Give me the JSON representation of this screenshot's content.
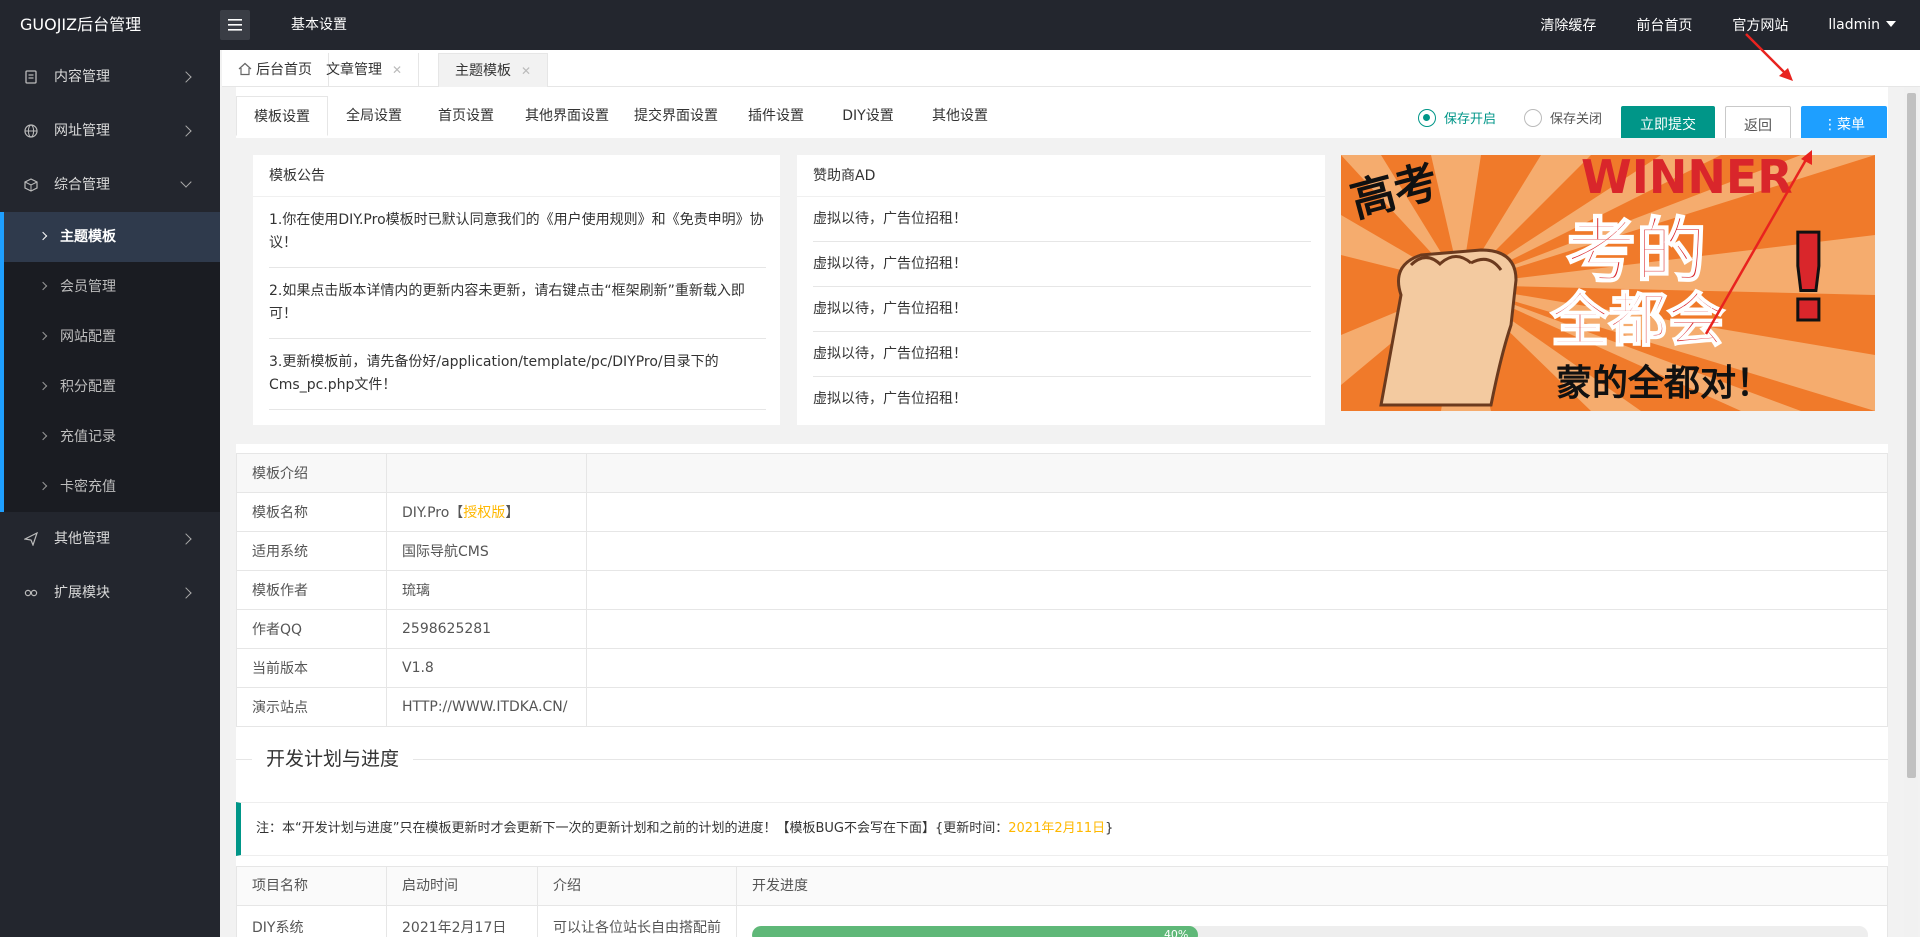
{
  "topbar": {
    "brand": "GUOJIZ后台管理",
    "basic": "基本设置",
    "links": [
      "清除缓存",
      "前台首页",
      "官方网站"
    ],
    "user": "lladmin"
  },
  "sidebar": {
    "items": [
      {
        "label": "内容管理",
        "icon": "file-icon"
      },
      {
        "label": "网址管理",
        "icon": "globe-icon"
      },
      {
        "label": "综合管理",
        "icon": "cube-icon"
      }
    ],
    "sub_items": [
      "主题模板",
      "会员管理",
      "网站配置",
      "积分配置",
      "充值记录",
      "卡密充值"
    ],
    "after_items": [
      {
        "label": "其他管理",
        "icon": "send-icon"
      },
      {
        "label": "扩展模块",
        "icon": "link-icon"
      }
    ]
  },
  "page_tabs": {
    "home": "后台首页",
    "articles": "文章管理",
    "theme": "主题模板"
  },
  "sub_tabs": [
    "模板设置",
    "全局设置",
    "首页设置",
    "其他界面设置",
    "提交界面设置",
    "插件设置",
    "DIY设置",
    "其他设置"
  ],
  "toolbar": {
    "save_on": "保存开启",
    "save_off": "保存关闭",
    "submit": "立即提交",
    "back": "返回",
    "menu": "⋮菜单"
  },
  "notice": {
    "title": "模板公告",
    "items": [
      "1.你在使用DIY.Pro模板时已默认同意我们的《用户使用规则》和《免责申明》协议！",
      "2.如果点击版本详情内的更新内容未更新，请右键点击“框架刷新”重新载入即可！",
      "3.更新模板前，请先备份好/application/template/pc/DIYPro/目录下的Cms_pc.php文件！"
    ]
  },
  "ads": {
    "title": "赞助商AD",
    "items": [
      "虚拟以待，广告位招租！",
      "虚拟以待，广告位招租！",
      "虚拟以待，广告位招租！",
      "虚拟以待，广告位招租！",
      "虚拟以待，广告位招租！"
    ]
  },
  "banner": {
    "line1": "考的",
    "line2": "全都会",
    "line3": "蒙的全都对！",
    "side": "高考",
    "english": "WINNER"
  },
  "info": {
    "header": "模板介绍",
    "rows": [
      {
        "label": "模板名称",
        "value": "DIY.Pro",
        "badge": "【授权版】"
      },
      {
        "label": "适用系统",
        "value": "国际导航CMS"
      },
      {
        "label": "模板作者",
        "value": "琉璃"
      },
      {
        "label": "作者QQ",
        "value": "2598625281"
      },
      {
        "label": "当前版本",
        "value": "V1.8"
      },
      {
        "label": "演示站点",
        "value": "HTTP://WWW.ITDKA.CN/"
      }
    ],
    "badge_pre": "【",
    "badge_text": "授权版",
    "badge_post": "】"
  },
  "plan": {
    "title": "开发计划与进度",
    "note_pre": "注：本“开发计划与进度”只在模板更新时才会更新下一次的更新计划和之前的计划的进度！【模板BUG不会写在下面】{更新时间：",
    "note_date": "2021年2月11日",
    "note_post": "}",
    "headers": [
      "项目名称",
      "启动时间",
      "介绍",
      "开发进度"
    ],
    "rows": [
      {
        "name": "DIY系统",
        "start": "2021年2月17日",
        "intro": "可以让各位站长自由搭配前",
        "progress": 40,
        "progress_label": "40%"
      }
    ]
  },
  "colors": {
    "accent": "#009688",
    "blue": "#1e9fff",
    "orange": "#ffb800",
    "dark": "#23262e"
  }
}
